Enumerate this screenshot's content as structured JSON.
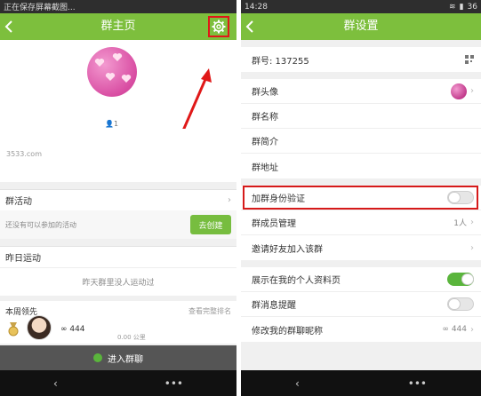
{
  "left": {
    "status_text": "正在保存屏幕截图...",
    "title": "群主页",
    "member_count": "1",
    "watermark": "3533.com",
    "activity": {
      "header": "群活动",
      "empty_text": "还没有可以参加的活动",
      "create_label": "去创建"
    },
    "yesterday": {
      "header": "昨日运动",
      "text": "昨天群里没人运动过"
    },
    "weekly": {
      "header": "本周领先",
      "link": "查看完整排名",
      "leader_name": "444",
      "leader_distance": "0.00 公里"
    },
    "enter_label": "进入群聊",
    "icons": {
      "back": "back-icon",
      "settings": "gear-icon",
      "annotation": "red-arrow",
      "medal": "medal-icon",
      "chat": "chat-icon"
    }
  },
  "right": {
    "status_time": "14:28",
    "status_battery": "36",
    "title": "群设置",
    "group_number": "群号: 137255",
    "rows": {
      "avatar": "群头像",
      "name": "群名称",
      "intro": "群简介",
      "address": "群地址",
      "verify": "加群身份验证",
      "members": "群成员管理",
      "members_value": "1人",
      "invite": "邀请好友加入该群",
      "show_profile": "展示在我的个人资料页",
      "notify": "群消息提醒",
      "nickname": "修改我的群聊昵称",
      "nickname_value": "444"
    },
    "toggles": {
      "verify": false,
      "show_profile": true,
      "notify": false
    }
  },
  "colors": {
    "accent": "#7dbf3d",
    "highlight": "#d61a1a",
    "toggle_on": "#5ab53c"
  }
}
